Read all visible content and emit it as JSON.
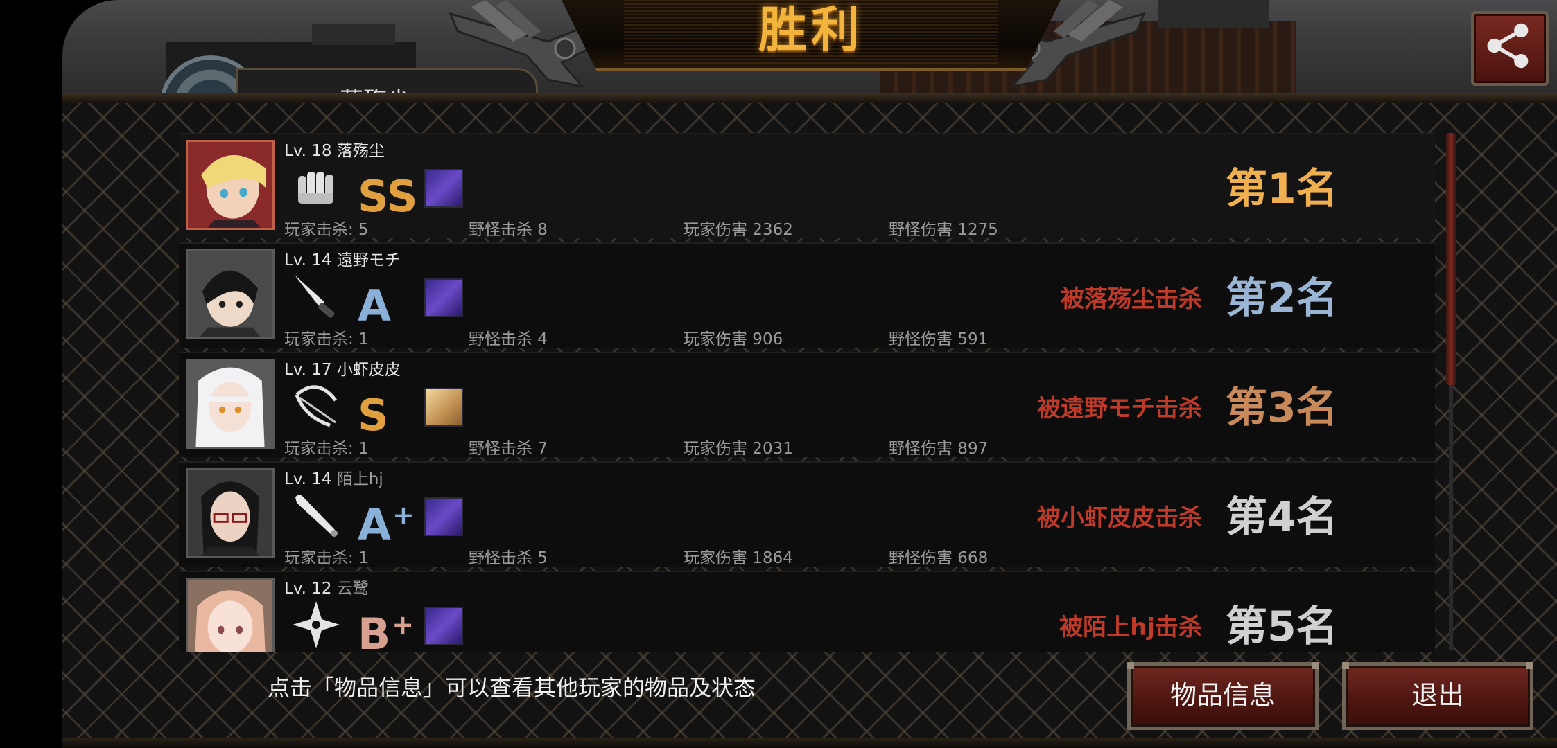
{
  "header": {
    "title": "胜利",
    "partial_player_name": "落殇尘"
  },
  "players": [
    {
      "level_name": "Lv. 18 落殇尘",
      "name_suffix": "",
      "weapon": "fist-icon",
      "grade": "SS",
      "grade_plus": "",
      "grade_color": "#e0a040",
      "item": "purple-item-icon",
      "killed_by": "",
      "rank": "第1名",
      "rank_color": "#f0b050",
      "stats": {
        "player_kills": "玩家击杀: 5",
        "monster_kills": "野怪击杀 8",
        "player_damage": "玩家伤害 2362",
        "monster_damage": "野怪伤害 1275"
      }
    },
    {
      "level_name": "Lv. 14 遠野モチ",
      "name_suffix": "",
      "weapon": "knife-icon",
      "grade": "A",
      "grade_plus": "",
      "grade_color": "#8ab0d8",
      "item": "purple-item-icon",
      "killed_by": "被落殇尘击杀",
      "rank": "第2名",
      "rank_color": "#9ab6d4",
      "stats": {
        "player_kills": "玩家击杀: 1",
        "monster_kills": "野怪击杀 4",
        "player_damage": "玩家伤害 906",
        "monster_damage": "野怪伤害 591"
      }
    },
    {
      "level_name": "Lv. 17 小虾皮皮",
      "name_suffix": "",
      "weapon": "bow-icon",
      "grade": "S",
      "grade_plus": "",
      "grade_color": "#e0a040",
      "item": "golden-item-icon",
      "killed_by": "被遠野モチ击杀",
      "rank": "第3名",
      "rank_color": "#c88a5a",
      "stats": {
        "player_kills": "玩家击杀: 1",
        "monster_kills": "野怪击杀 7",
        "player_damage": "玩家伤害 2031",
        "monster_damage": "野怪伤害 897"
      }
    },
    {
      "level_name": "Lv. 14 ",
      "name_suffix": "陌上hj",
      "weapon": "bat-icon",
      "grade": "A",
      "grade_plus": "+",
      "grade_color": "#8ab0d8",
      "item": "purple-item-icon",
      "killed_by": "被小虾皮皮击杀",
      "rank": "第4名",
      "rank_color": "#d0d0d0",
      "stats": {
        "player_kills": "玩家击杀: 1",
        "monster_kills": "野怪击杀 5",
        "player_damage": "玩家伤害 1864",
        "monster_damage": "野怪伤害 668"
      }
    },
    {
      "level_name": "Lv. 12 ",
      "name_suffix": "云鹭",
      "weapon": "shuriken-icon",
      "grade": "B",
      "grade_plus": "+",
      "grade_color": "#d8a090",
      "item": "purple-item-icon",
      "killed_by": "被陌上hj击杀",
      "rank": "第5名",
      "rank_color": "#d0d0d0",
      "stats": {
        "player_kills": "",
        "monster_kills": "",
        "player_damage": "",
        "monster_damage": ""
      }
    }
  ],
  "footer": {
    "hint": "点击「物品信息」可以查看其他玩家的物品及状态",
    "items_button": "物品信息",
    "exit_button": "退出"
  }
}
